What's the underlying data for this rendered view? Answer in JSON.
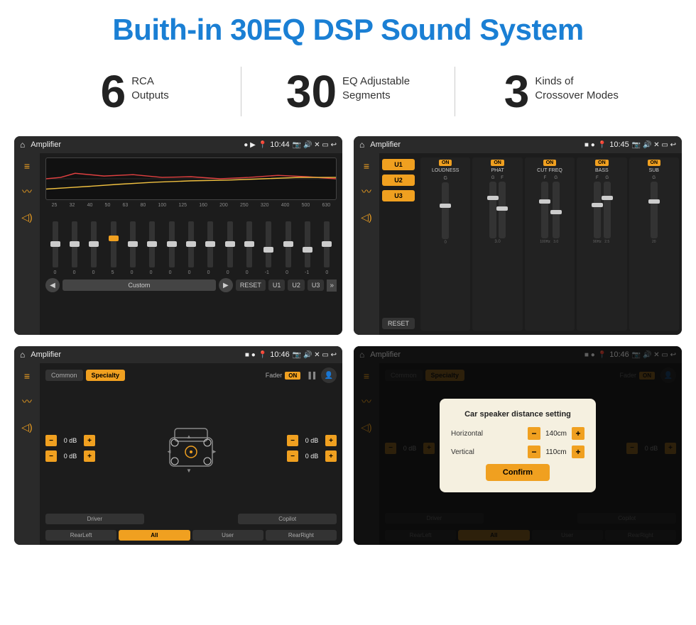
{
  "header": {
    "title": "Buith-in 30EQ DSP Sound System"
  },
  "stats": [
    {
      "number": "6",
      "line1": "RCA",
      "line2": "Outputs"
    },
    {
      "number": "30",
      "line1": "EQ Adjustable",
      "line2": "Segments"
    },
    {
      "number": "3",
      "line1": "Kinds of",
      "line2": "Crossover Modes"
    }
  ],
  "screens": [
    {
      "id": "eq-screen",
      "status_bar": {
        "title": "Amplifier",
        "time": "10:44"
      },
      "eq_freqs": [
        "25",
        "32",
        "40",
        "50",
        "63",
        "80",
        "100",
        "125",
        "160",
        "200",
        "250",
        "320",
        "400",
        "500",
        "630"
      ],
      "eq_vals": [
        "0",
        "0",
        "0",
        "5",
        "0",
        "0",
        "0",
        "0",
        "0",
        "0",
        "0",
        "-1",
        "0",
        "-1",
        "0"
      ],
      "eq_preset": "Custom",
      "buttons": [
        "RESET",
        "U1",
        "U2",
        "U3"
      ]
    },
    {
      "id": "amp-screen",
      "status_bar": {
        "title": "Amplifier",
        "time": "10:45"
      },
      "presets": [
        "U1",
        "U2",
        "U3"
      ],
      "channels": [
        {
          "label": "LOUDNESS",
          "on": true
        },
        {
          "label": "PHAT",
          "on": true
        },
        {
          "label": "CUT FREQ",
          "on": true
        },
        {
          "label": "BASS",
          "on": true
        },
        {
          "label": "SUB",
          "on": true
        }
      ],
      "reset_label": "RESET"
    },
    {
      "id": "ctl-screen",
      "status_bar": {
        "title": "Amplifier",
        "time": "10:46"
      },
      "tabs": [
        "Common",
        "Specialty"
      ],
      "fader_label": "Fader",
      "fader_on": true,
      "volume_rows": [
        {
          "value": "0 dB"
        },
        {
          "value": "0 dB"
        },
        {
          "value": "0 dB"
        },
        {
          "value": "0 dB"
        }
      ],
      "bottom_buttons": [
        "Driver",
        "",
        "Copilot",
        "RearLeft",
        "All",
        "User",
        "RearRight"
      ],
      "all_active": true
    },
    {
      "id": "dialog-screen",
      "status_bar": {
        "title": "Amplifier",
        "time": "10:46"
      },
      "tabs": [
        "Common",
        "Specialty"
      ],
      "dialog": {
        "title": "Car speaker distance setting",
        "rows": [
          {
            "label": "Horizontal",
            "value": "140cm"
          },
          {
            "label": "Vertical",
            "value": "110cm"
          }
        ],
        "confirm_label": "Confirm"
      },
      "volume_rows": [
        {
          "value": "0 dB"
        },
        {
          "value": "0 dB"
        }
      ]
    }
  ]
}
